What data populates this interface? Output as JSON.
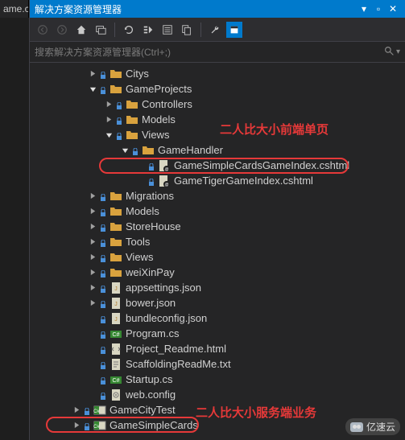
{
  "left_tab": "ame.cs",
  "title": "解决方案资源管理器",
  "search_placeholder": "搜索解决方案资源管理器(Ctrl+;)",
  "annotations": {
    "frontend": "二人比大小前端单页",
    "backend": "二人比大小服务端业务"
  },
  "watermark": "亿速云",
  "tree": {
    "n0": "Citys",
    "n1": "GameProjects",
    "n2": "Controllers",
    "n3": "Models",
    "n4": "Views",
    "n5": "GameHandler",
    "n6": "GameSimpleCardsGameIndex.cshtml",
    "n7": "GameTigerGameIndex.cshtml",
    "n8": "Migrations",
    "n9": "Models",
    "n10": "StoreHouse",
    "n11": "Tools",
    "n12": "Views",
    "n13": "weiXinPay",
    "n14": "appsettings.json",
    "n15": "bower.json",
    "n16": "bundleconfig.json",
    "n17": "Program.cs",
    "n18": "Project_Readme.html",
    "n19": "ScaffoldingReadMe.txt",
    "n20": "Startup.cs",
    "n21": "web.config",
    "n22": "GameCityTest",
    "n23": "GameSimpleCards"
  }
}
